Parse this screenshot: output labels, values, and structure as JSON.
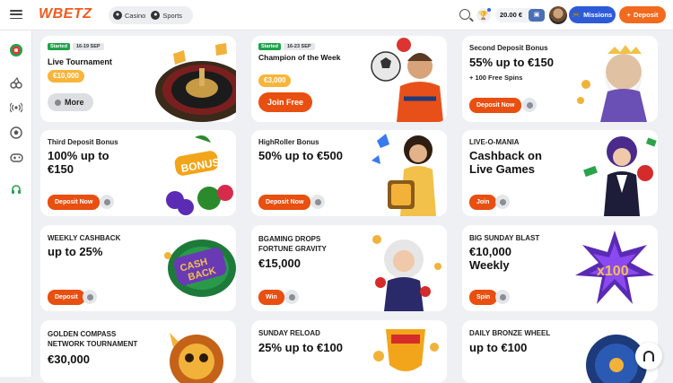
{
  "header": {
    "logo": "WBETZ",
    "casino_label": "Casino",
    "sports_label": "Sports",
    "balance": "20.00 €",
    "missions_label": "Missions",
    "deposit_label": "Deposit"
  },
  "cards": [
    {
      "started": "Started",
      "date": "16-19 SEP",
      "title": "Live Tournament",
      "amount": "€10,000",
      "button": "More"
    },
    {
      "started": "Started",
      "date": "16-23 SEP",
      "title": "Champion of the Week",
      "amount": "€3,000",
      "button": "Join Free"
    },
    {
      "sub": "Second Deposit Bonus",
      "title": "55% up to €150",
      "extra": "+ 100 Free Spins",
      "button": "Deposit Now"
    },
    {
      "sub": "Third Deposit Bonus",
      "title": "100% up to €150",
      "button": "Deposit Now"
    },
    {
      "sub": "HighRoller Bonus",
      "title": "50% up to €500",
      "button": "Deposit Now"
    },
    {
      "sub": "LIVE-O-MANIA",
      "title": "Cashback on Live Games",
      "button": "Join"
    },
    {
      "sub": "WEEKLY CASHBACK",
      "title": "up to 25%",
      "button": "Deposit"
    },
    {
      "sub": "BGAMING DROPS FORTUNE GRAVITY",
      "title": "€15,000",
      "button": "Win"
    },
    {
      "sub": "BIG SUNDAY BLAST",
      "title": "€10,000 Weekly",
      "button": "Spin"
    },
    {
      "sub": "GOLDEN COMPASS NETWORK TOURNAMENT",
      "title": "€30,000"
    },
    {
      "sub": "SUNDAY RELOAD",
      "title": "25% up to €100"
    },
    {
      "sub": "DAILY BRONZE WHEEL",
      "title": "up to €100"
    }
  ],
  "colors": {
    "accent": "#e84f10",
    "missions": "#2d5bd8",
    "started": "#1ea34a",
    "pill": "#f9b53a"
  }
}
